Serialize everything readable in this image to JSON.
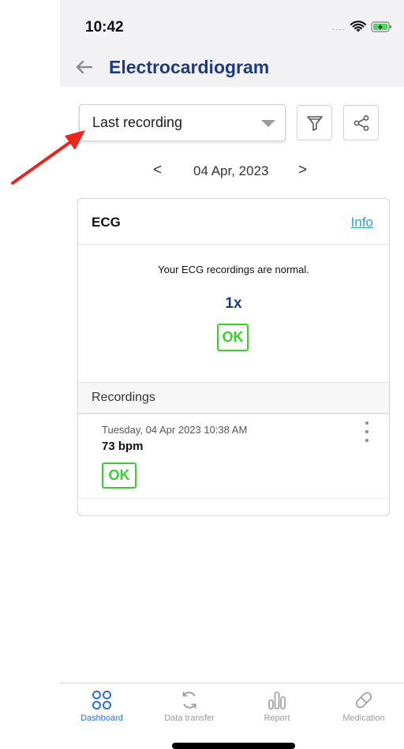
{
  "status_bar": {
    "time": "10:42",
    "signal_dots": "....",
    "icons": [
      "wifi-icon",
      "battery-charging-icon"
    ]
  },
  "header": {
    "title": "Electrocardiogram",
    "back_icon": "back-arrow-icon"
  },
  "filter": {
    "selected": "Last recording",
    "filter_icon": "filter-icon",
    "share_icon": "share-icon"
  },
  "date_nav": {
    "prev": "<",
    "date": "04 Apr, 2023",
    "next": ">"
  },
  "card": {
    "title": "ECG",
    "info_link": "Info",
    "summary_text": "Your ECG recordings are normal.",
    "count": "1x",
    "status": "OK",
    "recordings_heading": "Recordings",
    "recordings": [
      {
        "datetime": "Tuesday, 04 Apr 2023 10:38 AM",
        "bpm": "73 bpm",
        "status": "OK"
      }
    ]
  },
  "tabbar": {
    "tabs": [
      {
        "label": "Dashboard",
        "icon": "dashboard-icon",
        "active": true
      },
      {
        "label": "Data transfer",
        "icon": "sync-icon",
        "active": false
      },
      {
        "label": "Report",
        "icon": "report-icon",
        "active": false
      },
      {
        "label": "Medication",
        "icon": "pill-icon",
        "active": false
      }
    ]
  },
  "colors": {
    "title": "#1f3b7a",
    "ok_green": "#37d12e",
    "link_blue": "#2a9fd6",
    "active_tab": "#2b6fd6",
    "annotation_arrow": "#e8261f"
  }
}
